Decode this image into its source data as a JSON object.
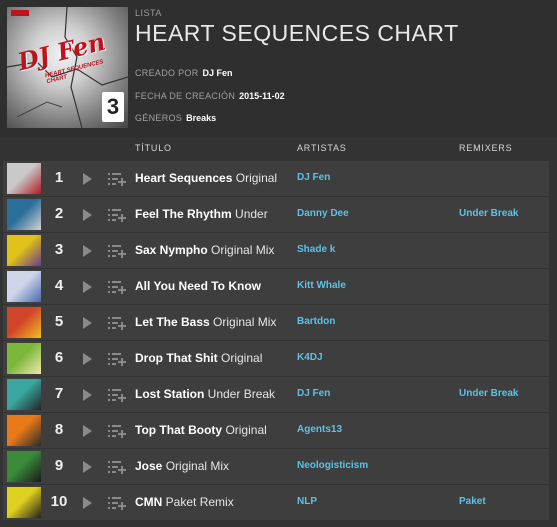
{
  "header": {
    "eyebrow": "LISTA",
    "title": "HEART SEQUENCES CHART",
    "created_by_label": "CREADO POR",
    "created_by": "DJ Fen",
    "date_label": "FECHA DE CREACIÓN",
    "date": "2015-11-02",
    "genres_label": "GÉNEROS",
    "genres": "Breaks",
    "cover_text": "DJ Fen",
    "cover_number": "3"
  },
  "columns": {
    "title": "TÍTULO",
    "artists": "ARTISTAS",
    "remixers": "REMIXERS"
  },
  "icons": {
    "play": "play-icon",
    "queue": "add-to-queue-icon"
  },
  "colors": {
    "link": "#5cc2e8",
    "row_bg": "#3e3e3e",
    "page_bg": "#333333"
  },
  "tracks": [
    {
      "num": "1",
      "name": "Heart Sequences",
      "mix": "Original",
      "artist": "DJ Fen",
      "remixer": "",
      "thumb": [
        "#c9c9c9",
        "#b01a22"
      ]
    },
    {
      "num": "2",
      "name": "Feel The Rhythm",
      "mix": "Under",
      "artist": "Danny Dee",
      "remixer": "Under Break",
      "thumb": [
        "#2a6e9a",
        "#d2d2d2"
      ]
    },
    {
      "num": "3",
      "name": "Sax Nympho",
      "mix": "Original Mix",
      "artist": "Shade k",
      "remixer": "",
      "thumb": [
        "#e0c21a",
        "#6a3a8c"
      ]
    },
    {
      "num": "4",
      "name": "All You Need To Know",
      "mix": "",
      "artist": "Kitt Whale",
      "remixer": "",
      "thumb": [
        "#cfd6e8",
        "#4a68b0"
      ]
    },
    {
      "num": "5",
      "name": "Let The Bass",
      "mix": "Original Mix",
      "artist": "Bartdon",
      "remixer": "",
      "thumb": [
        "#d1452a",
        "#f0c020"
      ]
    },
    {
      "num": "6",
      "name": "Drop That Shit",
      "mix": "Original",
      "artist": "K4DJ",
      "remixer": "",
      "thumb": [
        "#7ab83a",
        "#f5e6b0"
      ]
    },
    {
      "num": "7",
      "name": "Lost Station",
      "mix": "Under Break",
      "artist": "DJ Fen",
      "remixer": "Under Break",
      "thumb": [
        "#3aa8a0",
        "#222222"
      ]
    },
    {
      "num": "8",
      "name": "Top That Booty",
      "mix": "Original",
      "artist": "Agents13",
      "remixer": "",
      "thumb": [
        "#e87a1a",
        "#2a2a2a"
      ]
    },
    {
      "num": "9",
      "name": "Jose",
      "mix": "Original Mix",
      "artist": "Neologisticism",
      "remixer": "",
      "thumb": [
        "#3a8a3a",
        "#1a1a1a"
      ]
    },
    {
      "num": "10",
      "name": "CMN",
      "mix": "Paket Remix",
      "artist": "NLP",
      "remixer": "Paket",
      "thumb": [
        "#e0d020",
        "#202020"
      ]
    }
  ]
}
